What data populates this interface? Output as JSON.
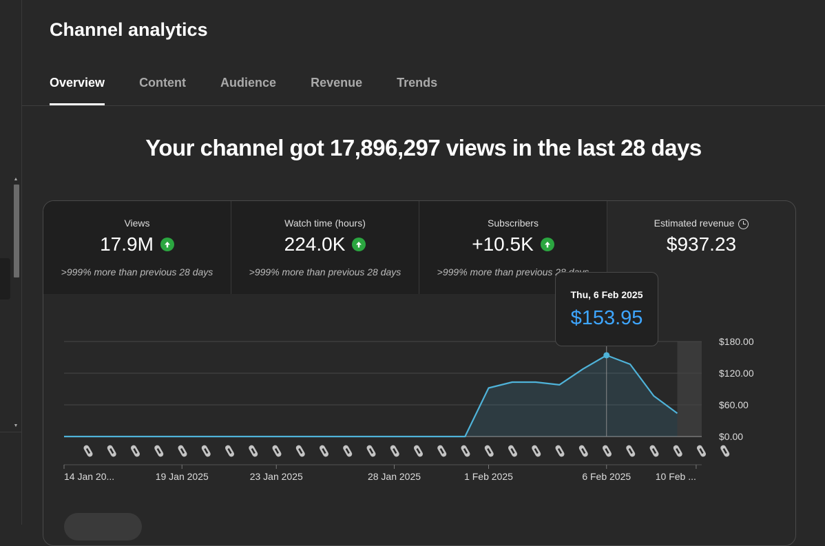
{
  "page": {
    "title": "Channel analytics"
  },
  "tabs": [
    {
      "label": "Overview",
      "active": true
    },
    {
      "label": "Content",
      "active": false
    },
    {
      "label": "Audience",
      "active": false
    },
    {
      "label": "Revenue",
      "active": false
    },
    {
      "label": "Trends",
      "active": false
    }
  ],
  "headline": "Your channel got 17,896,297 views in the last 28 days",
  "metrics": [
    {
      "label": "Views",
      "value": "17.9M",
      "trend": "up",
      "note": ">999% more than previous 28 days"
    },
    {
      "label": "Watch time (hours)",
      "value": "224.0K",
      "trend": "up",
      "note": ">999% more than previous 28 days"
    },
    {
      "label": "Subscribers",
      "value": "+10.5K",
      "trend": "up",
      "note": ">999% more than previous 28 days"
    },
    {
      "label": "Estimated revenue",
      "value": "$937.23",
      "icon": "clock-icon",
      "selected": true
    }
  ],
  "tooltip": {
    "date": "Thu, 6 Feb 2025",
    "value": "$153.95"
  },
  "colors": {
    "accent": "#3ea6ff",
    "line": "#4fb3d9",
    "trend_up": "#2ba640"
  },
  "chart_data": {
    "type": "area",
    "series": [
      {
        "name": "Estimated revenue",
        "values": [
          0,
          0,
          0,
          0,
          0,
          0,
          0,
          0,
          0,
          0,
          0,
          0,
          0,
          0,
          0,
          0,
          0,
          0,
          92,
          103,
          103,
          98,
          128,
          153.95,
          137,
          77,
          44
        ]
      }
    ],
    "point_count": 27,
    "x_tick_labels": [
      {
        "index": 0,
        "label": "14 Jan 20..."
      },
      {
        "index": 5,
        "label": "19 Jan 2025"
      },
      {
        "index": 9,
        "label": "23 Jan 2025"
      },
      {
        "index": 14,
        "label": "28 Jan 2025"
      },
      {
        "index": 18,
        "label": "1 Feb 2025"
      },
      {
        "index": 23,
        "label": "6 Feb 2025"
      },
      {
        "index": 26.8,
        "label": "10 Feb ..."
      }
    ],
    "y_ticks": [
      "$0.00",
      "$60.00",
      "$120.00",
      "$180.00"
    ],
    "y_tick_values": [
      0,
      60,
      120,
      180
    ],
    "ylim": [
      0,
      180
    ],
    "highlight_index": 23,
    "grid": true,
    "shorts_icon_count": 28
  }
}
